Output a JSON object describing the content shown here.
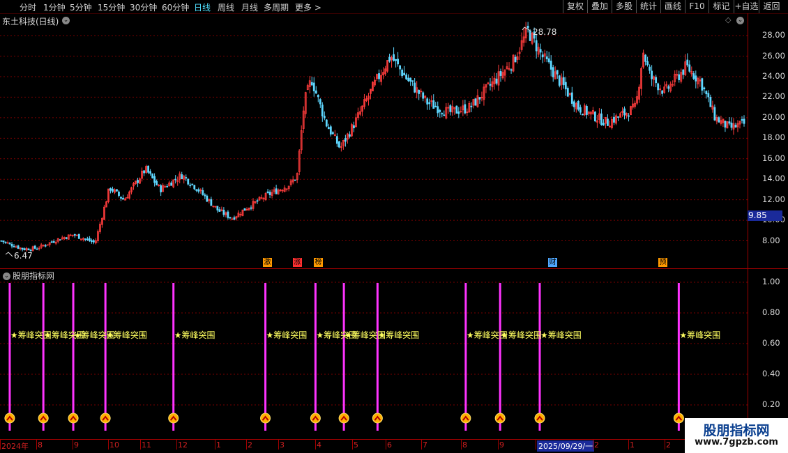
{
  "toolbar": {
    "periods": [
      "分时",
      "1分钟",
      "5分钟",
      "15分钟",
      "30分钟",
      "60分钟",
      "日线",
      "周线",
      "月线",
      "多周期",
      "更多 >"
    ],
    "active_period": "日线",
    "buttons": [
      "复权",
      "叠加",
      "多股",
      "统计",
      "画线",
      "F10",
      "标记",
      "+自选",
      "返回"
    ]
  },
  "main_pane": {
    "title": "东土科技(日线)",
    "max_label": "28.78",
    "min_label": "6.47",
    "current_price": "9.85",
    "y_ticks": [
      "28.00",
      "26.00",
      "24.00",
      "22.00",
      "20.00",
      "18.00",
      "16.00",
      "14.00",
      "12.00",
      "10.00",
      "8.00"
    ],
    "badges": [
      {
        "text": "激",
        "color": "#ff9900"
      },
      {
        "text": "涨",
        "color": "#ff3030"
      },
      {
        "text": "榜",
        "color": "#ff9900"
      },
      {
        "text": "财",
        "color": "#4fa8ff"
      },
      {
        "text": "预",
        "color": "#ff9900"
      }
    ]
  },
  "indicator_pane": {
    "title": "股朋指标网",
    "y_ticks": [
      "1.00",
      "0.80",
      "0.60",
      "0.40",
      "0.20"
    ],
    "signal_label": "★筹峰突围",
    "signal_count": 12
  },
  "x_axis": {
    "labels": [
      "2024年",
      "8",
      "9",
      "10",
      "11",
      "12",
      "1",
      "2",
      "3",
      "4",
      "5",
      "6",
      "7",
      "8",
      "9",
      "2025/09/29/一",
      "2",
      "1",
      "2"
    ]
  },
  "watermark": {
    "title": "股朋指标网",
    "url": "www.7gpzb.com"
  },
  "colors": {
    "up": "#ff3c3c",
    "down": "#5fd7ff",
    "grid": "#7a0000",
    "signal": "#ff33ff",
    "signal_text": "#ffff60"
  },
  "chart_data": {
    "type": "candlestick",
    "price_range": [
      6.47,
      28.78
    ],
    "price_path": [
      [
        0,
        8.0
      ],
      [
        3,
        7.2
      ],
      [
        5,
        7.3
      ],
      [
        8,
        8.2
      ],
      [
        10,
        8.6
      ],
      [
        13,
        7.8
      ],
      [
        14,
        10.5
      ],
      [
        15,
        13.2
      ],
      [
        17,
        12.0
      ],
      [
        20,
        15.0
      ],
      [
        22,
        13.0
      ],
      [
        25,
        14.4
      ],
      [
        27,
        13.2
      ],
      [
        30,
        11.0
      ],
      [
        32,
        10.2
      ],
      [
        34,
        11.2
      ],
      [
        37,
        12.5
      ],
      [
        40,
        13.5
      ],
      [
        41,
        14.3
      ],
      [
        42,
        21.5
      ],
      [
        43,
        23.8
      ],
      [
        45,
        19.5
      ],
      [
        47,
        17.0
      ],
      [
        49,
        19.5
      ],
      [
        52,
        23.6
      ],
      [
        54,
        26.0
      ],
      [
        56,
        24.0
      ],
      [
        59,
        21.5
      ],
      [
        62,
        20.5
      ],
      [
        65,
        21.0
      ],
      [
        68,
        23.3
      ],
      [
        71,
        25.5
      ],
      [
        73,
        28.5
      ],
      [
        75,
        26.0
      ],
      [
        77,
        24.0
      ],
      [
        80,
        21.0
      ],
      [
        84,
        19.5
      ],
      [
        88,
        21.0
      ],
      [
        89,
        26.5
      ],
      [
        90,
        24.0
      ],
      [
        92,
        22.5
      ],
      [
        95,
        25.0
      ],
      [
        97,
        23.5
      ],
      [
        99,
        20.0
      ],
      [
        101,
        19.0
      ],
      [
        103,
        19.4
      ]
    ],
    "signal_positions": [
      0.013,
      0.058,
      0.098,
      0.141,
      0.232,
      0.355,
      0.422,
      0.46,
      0.505,
      0.623,
      0.669,
      0.722,
      0.908
    ]
  }
}
